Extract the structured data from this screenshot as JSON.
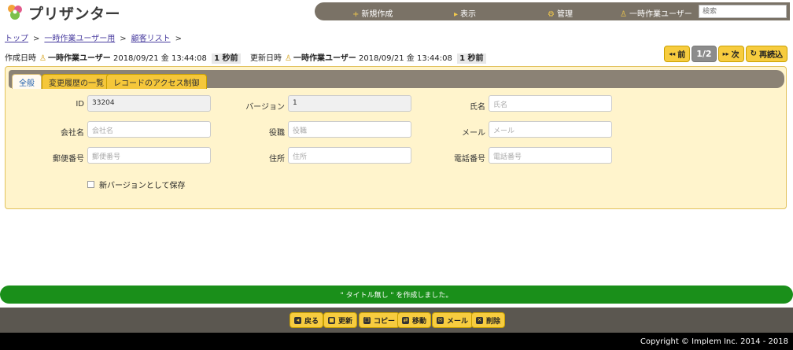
{
  "app": {
    "title": "プリザンター"
  },
  "nav": {
    "new": "新規作成",
    "view": "表示",
    "admin": "管理",
    "user": "一時作業ユーザー",
    "search_placeholder": "検索"
  },
  "breadcrumb": [
    {
      "label": "トップ"
    },
    {
      "label": "一時作業ユーザー用"
    },
    {
      "label": "顧客リスト"
    }
  ],
  "breadcrumb_sep": ">",
  "meta": {
    "created_label": "作成日時",
    "created_user": "一時作業ユーザー",
    "created_date": "2018/09/21 金 13:44:08",
    "created_ago": "1 秒前",
    "updated_label": "更新日時",
    "updated_user": "一時作業ユーザー",
    "updated_date": "2018/09/21 金 13:44:08",
    "updated_ago": "1 秒前"
  },
  "pager": {
    "prev": "前",
    "page": "1/2",
    "next": "次",
    "reload": "再読込"
  },
  "tabs": [
    {
      "label": "全般",
      "active": true
    },
    {
      "label": "変更履歴の一覧",
      "active": false
    },
    {
      "label": "レコードのアクセス制御",
      "active": false
    }
  ],
  "fields": {
    "id": {
      "label": "ID",
      "value": "33204"
    },
    "version": {
      "label": "バージョン",
      "value": "1"
    },
    "name": {
      "label": "氏名",
      "placeholder": "氏名"
    },
    "company": {
      "label": "会社名",
      "placeholder": "会社名"
    },
    "title": {
      "label": "役職",
      "placeholder": "役職"
    },
    "mail": {
      "label": "メール",
      "placeholder": "メール"
    },
    "zip": {
      "label": "郵便番号",
      "placeholder": "郵便番号"
    },
    "address": {
      "label": "住所",
      "placeholder": "住所"
    },
    "phone": {
      "label": "電話番号",
      "placeholder": "電話番号"
    }
  },
  "save_as_new_version": "新バージョンとして保存",
  "message": "\" タイトル無し \" を作成しました。",
  "actions": {
    "back": "戻る",
    "update": "更新",
    "copy": "コピー",
    "move": "移動",
    "mail": "メール",
    "delete": "削除"
  },
  "footer": {
    "copyright": "Copyright © Implem Inc. 2014 - 2018"
  },
  "colors": {
    "accent": "#f7cc3f",
    "nav_bg": "#7a7266",
    "panel_bg": "#fff4cc",
    "success": "#1a8f1a"
  }
}
